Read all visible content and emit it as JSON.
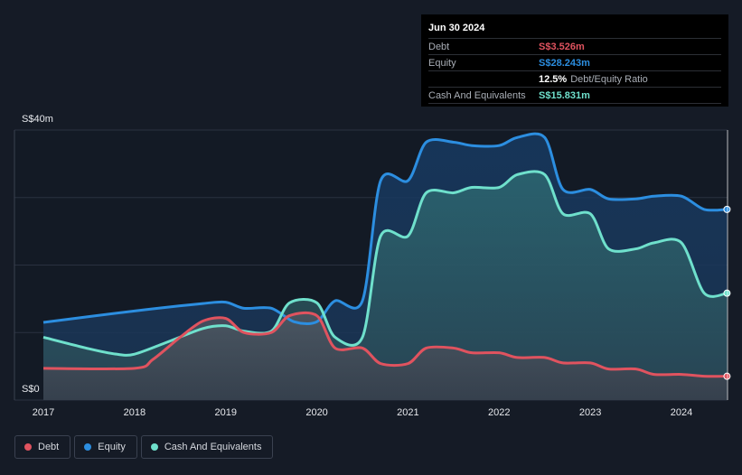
{
  "colors": {
    "debt": "#e0535f",
    "equity": "#2c8ee0",
    "cash": "#6fe0cc",
    "grid": "#2a3140",
    "axis_text": "#e6e8ec"
  },
  "tooltip": {
    "date": "Jun 30 2024",
    "rows": [
      {
        "label": "Debt",
        "value": "S$3.526m",
        "color": "#e0535f",
        "extra": ""
      },
      {
        "label": "Equity",
        "value": "S$28.243m",
        "color": "#2c8ee0",
        "extra": ""
      },
      {
        "label": "",
        "value": "12.5%",
        "color": "#ffffff",
        "extra": "Debt/Equity Ratio"
      },
      {
        "label": "Cash And Equivalents",
        "value": "S$15.831m",
        "color": "#6fe0cc",
        "extra": ""
      }
    ]
  },
  "legend": [
    {
      "name": "Debt",
      "color": "#e0535f"
    },
    {
      "name": "Equity",
      "color": "#2c8ee0"
    },
    {
      "name": "Cash And Equivalents",
      "color": "#6fe0cc"
    }
  ],
  "chart_data": {
    "type": "area",
    "title": "",
    "xlabel": "",
    "ylabel": "",
    "y_tick_labels": [
      "S$40m",
      "S$0"
    ],
    "x_tick_labels": [
      "2017",
      "2018",
      "2019",
      "2020",
      "2021",
      "2022",
      "2023",
      "2024"
    ],
    "ylim": [
      0,
      40
    ],
    "xlim": [
      2017.0,
      2024.5
    ],
    "grid": true,
    "legend_position": "bottom-left",
    "series": [
      {
        "name": "Equity",
        "color": "#2c8ee0",
        "points": [
          [
            2017.0,
            11.5
          ],
          [
            2018.0,
            13.2
          ],
          [
            2018.75,
            14.3
          ],
          [
            2019.0,
            14.5
          ],
          [
            2019.2,
            13.6
          ],
          [
            2019.5,
            13.6
          ],
          [
            2019.75,
            11.6
          ],
          [
            2020.0,
            11.6
          ],
          [
            2020.2,
            14.7
          ],
          [
            2020.5,
            14.7
          ],
          [
            2020.7,
            32.5
          ],
          [
            2021.0,
            32.5
          ],
          [
            2021.2,
            38.2
          ],
          [
            2021.5,
            38.2
          ],
          [
            2021.7,
            37.7
          ],
          [
            2022.0,
            37.7
          ],
          [
            2022.2,
            38.9
          ],
          [
            2022.5,
            38.9
          ],
          [
            2022.7,
            31.2
          ],
          [
            2023.0,
            31.2
          ],
          [
            2023.2,
            29.8
          ],
          [
            2023.5,
            29.8
          ],
          [
            2023.7,
            30.2
          ],
          [
            2024.0,
            30.2
          ],
          [
            2024.25,
            28.243
          ],
          [
            2024.5,
            28.243
          ]
        ]
      },
      {
        "name": "Cash And Equivalents",
        "color": "#6fe0cc",
        "points": [
          [
            2017.0,
            9.3
          ],
          [
            2017.5,
            7.6
          ],
          [
            2017.8,
            6.8
          ],
          [
            2018.0,
            6.8
          ],
          [
            2018.4,
            8.8
          ],
          [
            2018.75,
            10.6
          ],
          [
            2019.0,
            11.0
          ],
          [
            2019.2,
            10.2
          ],
          [
            2019.5,
            10.2
          ],
          [
            2019.7,
            14.4
          ],
          [
            2020.0,
            14.4
          ],
          [
            2020.2,
            9.3
          ],
          [
            2020.5,
            9.3
          ],
          [
            2020.7,
            24.3
          ],
          [
            2021.0,
            24.3
          ],
          [
            2021.2,
            30.7
          ],
          [
            2021.5,
            30.7
          ],
          [
            2021.7,
            31.5
          ],
          [
            2022.0,
            31.5
          ],
          [
            2022.2,
            33.4
          ],
          [
            2022.5,
            33.4
          ],
          [
            2022.7,
            27.6
          ],
          [
            2023.0,
            27.6
          ],
          [
            2023.2,
            22.4
          ],
          [
            2023.5,
            22.4
          ],
          [
            2023.7,
            23.3
          ],
          [
            2024.0,
            23.3
          ],
          [
            2024.25,
            15.831
          ],
          [
            2024.5,
            15.831
          ]
        ]
      },
      {
        "name": "Debt",
        "color": "#e0535f",
        "points": [
          [
            2017.0,
            4.7
          ],
          [
            2018.0,
            4.7
          ],
          [
            2018.2,
            6.0
          ],
          [
            2018.5,
            9.3
          ],
          [
            2018.75,
            11.7
          ],
          [
            2019.0,
            12.1
          ],
          [
            2019.2,
            10.0
          ],
          [
            2019.5,
            10.0
          ],
          [
            2019.7,
            12.5
          ],
          [
            2020.0,
            12.5
          ],
          [
            2020.2,
            7.7
          ],
          [
            2020.5,
            7.7
          ],
          [
            2020.7,
            5.4
          ],
          [
            2021.0,
            5.4
          ],
          [
            2021.2,
            7.7
          ],
          [
            2021.5,
            7.7
          ],
          [
            2021.7,
            7.0
          ],
          [
            2022.0,
            7.0
          ],
          [
            2022.2,
            6.3
          ],
          [
            2022.5,
            6.3
          ],
          [
            2022.7,
            5.5
          ],
          [
            2023.0,
            5.5
          ],
          [
            2023.2,
            4.6
          ],
          [
            2023.5,
            4.6
          ],
          [
            2023.7,
            3.8
          ],
          [
            2024.0,
            3.8
          ],
          [
            2024.25,
            3.526
          ],
          [
            2024.5,
            3.526
          ]
        ]
      }
    ]
  }
}
